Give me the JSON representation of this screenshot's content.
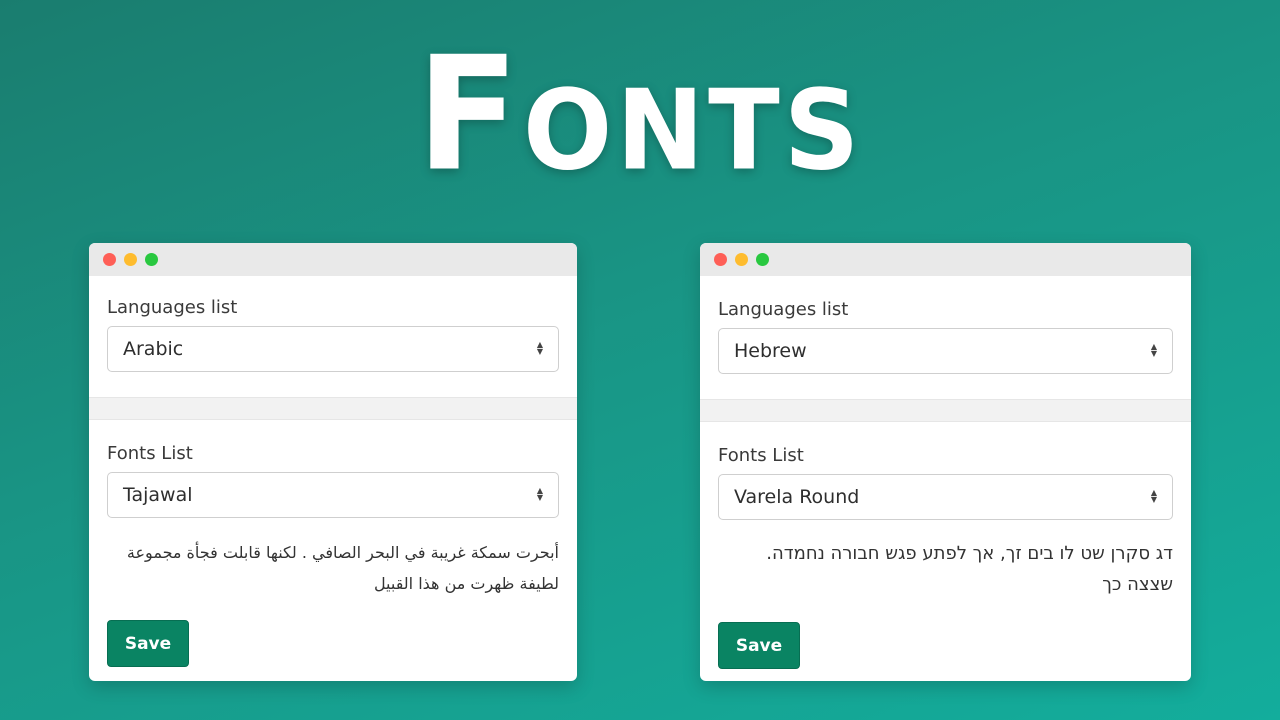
{
  "hero": {
    "title": "Fonts"
  },
  "colors": {
    "background_start": "#1a7d6f",
    "background_end": "#13ad9c",
    "save_button": "#0a8463",
    "dot_red": "#fe5f57",
    "dot_yellow": "#febc2e",
    "dot_green": "#29c840"
  },
  "windows": [
    {
      "languages_label": "Languages list",
      "language_value": "Arabic",
      "fonts_label": "Fonts List",
      "font_value": "Tajawal",
      "sample_text": "أبحرت سمكة غريبة في البحر الصافي . لكنها قابلت فجأة مجموعة لطيفة ظهرت من هذا القبيل",
      "save_label": "Save"
    },
    {
      "languages_label": "Languages list",
      "language_value": "Hebrew",
      "fonts_label": "Fonts List",
      "font_value": "Varela Round",
      "sample_text": "דג סקרן שט לו בים זך, אך לפתע פגש חבורה נחמדה. שצצה כך",
      "save_label": "Save"
    }
  ]
}
